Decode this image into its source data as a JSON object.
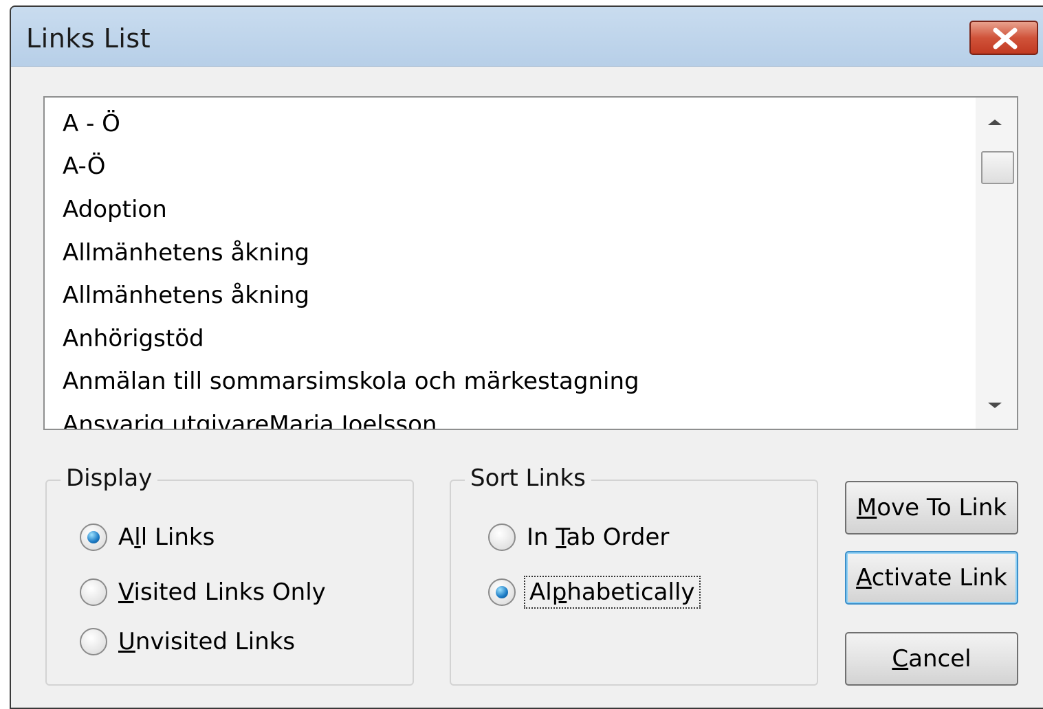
{
  "window": {
    "title": "Links List"
  },
  "links": [
    "A - Ö",
    "A-Ö",
    "Adoption",
    "Allmänhetens åkning",
    "Allmänhetens åkning",
    "Anhörigstöd",
    "Anmälan till sommarsimskola och märkestagning",
    "Ansvarig utgivareMaria Joelsson"
  ],
  "display": {
    "legend": "Display",
    "options": [
      {
        "pre": "A",
        "ul": "l",
        "post": "l Links",
        "checked": true
      },
      {
        "pre": "",
        "ul": "V",
        "post": "isited Links Only",
        "checked": false
      },
      {
        "pre": "",
        "ul": "U",
        "post": "nvisited Links",
        "checked": false
      }
    ]
  },
  "sort": {
    "legend": "Sort Links",
    "options": [
      {
        "pre": "In ",
        "ul": "T",
        "post": "ab Order",
        "checked": false
      },
      {
        "pre": "Al",
        "ul": "p",
        "post": "habetically",
        "checked": true
      }
    ]
  },
  "buttons": {
    "move": {
      "ul": "M",
      "post": "ove To Link"
    },
    "activate": {
      "ul": "A",
      "post": "ctivate Link"
    },
    "cancel": {
      "ul": "C",
      "post": "ancel"
    }
  }
}
